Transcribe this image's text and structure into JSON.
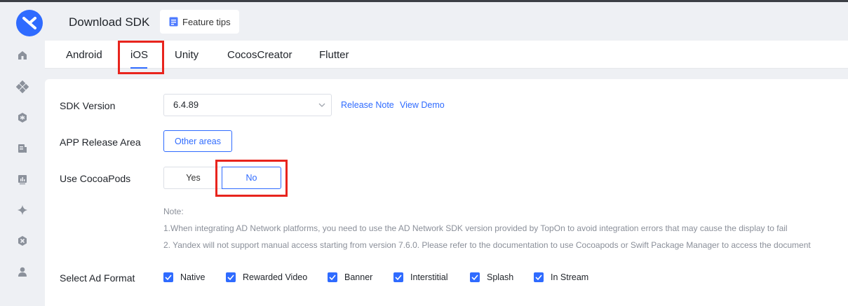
{
  "header": {
    "title": "Download SDK",
    "feature_tips": "Feature tips"
  },
  "sidebar": {
    "icons": [
      "home-icon",
      "apps-icon",
      "settings-hex-icon",
      "report-icon",
      "chart-icon",
      "sparkle-icon",
      "tools-icon",
      "user-icon"
    ]
  },
  "tabs": [
    {
      "label": "Android"
    },
    {
      "label": "iOS",
      "active": true
    },
    {
      "label": "Unity"
    },
    {
      "label": "CocosCreator"
    },
    {
      "label": "Flutter"
    }
  ],
  "form": {
    "sdk_version_label": "SDK Version",
    "sdk_version_value": "6.4.89",
    "release_note": "Release Note",
    "view_demo": "View Demo",
    "release_area_label": "APP Release Area",
    "release_area_button": "Other areas",
    "cocoapods_label": "Use CocoaPods",
    "cocoapods_yes": "Yes",
    "cocoapods_no": "No",
    "cocoapods_selected": "No",
    "note_title": "Note:",
    "note_1": "1.When integrating AD Network platforms, you need to use the AD Network SDK version provided by TopOn to avoid integration errors that may cause the display to fail",
    "note_2": "2. Yandex will not support manual access starting from version 7.6.0. Please refer to the documentation to use Cocoapods or Swift Package Manager to access the document",
    "ad_format_label": "Select Ad Format",
    "ad_formats": [
      {
        "label": "Native",
        "checked": true
      },
      {
        "label": "Rewarded Video",
        "checked": true
      },
      {
        "label": "Banner",
        "checked": true
      },
      {
        "label": "Interstitial",
        "checked": true
      },
      {
        "label": "Splash",
        "checked": true
      },
      {
        "label": "In Stream",
        "checked": true
      }
    ]
  },
  "colors": {
    "accent": "#2f6bff",
    "highlight_box": "#e8241d"
  }
}
